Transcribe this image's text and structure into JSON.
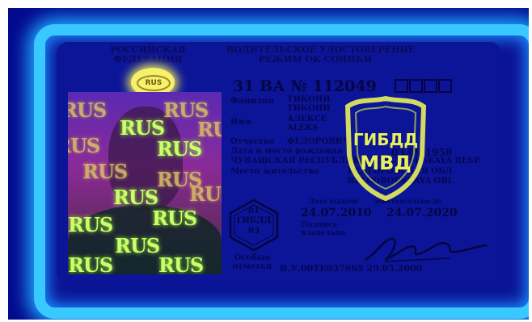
{
  "card": {
    "country": [
      "РОССИЙСКАЯ",
      "ФЕДЕРАЦИЯ"
    ],
    "title": [
      "ВОДИТЕЛЬСКОЕ УДОСТОВЕРЕНИЕ",
      "РЕЖИМ ОК СОНИКИ"
    ],
    "rus_emblem": "RUS",
    "number": "31 ВА № 112049",
    "fields": {
      "surname_label": "Фамилия",
      "surname_value": "ТИКОНИ\nТИКОНИ",
      "name_label": "Имя",
      "name_value": "АЛЕКСЕ\nALEKS",
      "patronymic_label": "Отчество",
      "patronymic_value": "ФЕДОРОВИЧ",
      "dob_label": "Дата и место рождения",
      "dob_value": "03.09.1958",
      "birthplace_value": "ЧУВАШСКАЯ РЕСПУБЛИКА / CHUVASHSKAYA RESP.",
      "residence_label": "Место жительства",
      "residence_value": "БЕЛГОРОДСКАЯ ОБЛ",
      "residence_value_latin": "BELGORODSKAYA OBL",
      "issued_label": "Дата выдачи",
      "issued_value": "24.07.2010",
      "expiry_label": "действительно до",
      "expiry_value": "24.07.2020",
      "holder_sign_label": "Подпись владельца",
      "notes_label": "Особые отметки",
      "notes_value": "В.У.00ТЕ037665 29.05.2000"
    },
    "shield_text": [
      "ГИБДД",
      "МВД"
    ],
    "hex_stamp": [
      "01",
      "ГИБДД",
      "03"
    ],
    "photo_watermark": "RUS"
  }
}
